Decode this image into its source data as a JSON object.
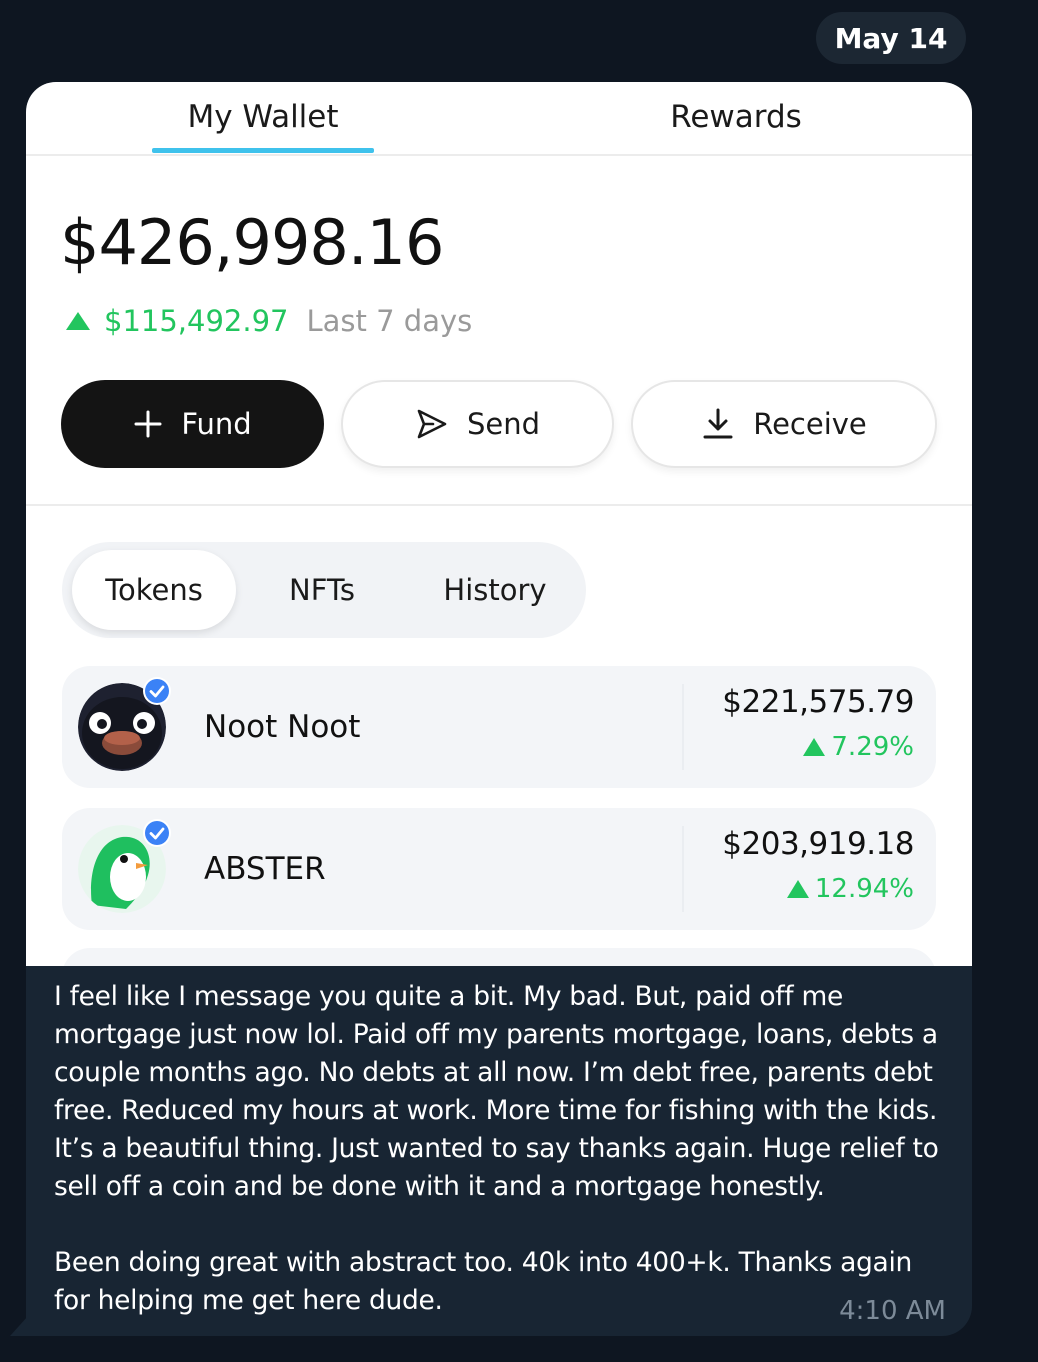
{
  "chat": {
    "date": "May 14",
    "message": "I feel like I message you quite a bit. My bad. But, paid off me mortgage just now lol. Paid off my parents mortgage, loans, debts a couple months ago. No debts at all now. I’m debt free, parents debt free. Reduced my hours at work. More time for fishing with the kids. It’s a beautiful thing. Just wanted to say thanks again. Huge relief to sell off a coin and be done with it and a mortgage honestly.\n\nBeen doing great with abstract too. 40k into 400+k. Thanks again for helping me get here dude.",
    "time": "4:10 AM"
  },
  "wallet": {
    "tabs": [
      "My Wallet",
      "Rewards"
    ],
    "active_tab": "My Wallet",
    "balance": "$426,998.16",
    "change": {
      "value": "$115,492.97",
      "period": "Last 7 days",
      "direction": "up"
    },
    "actions": [
      {
        "label": "Fund",
        "icon": "plus-icon"
      },
      {
        "label": "Send",
        "icon": "send-icon"
      },
      {
        "label": "Receive",
        "icon": "download-icon"
      }
    ],
    "segments": [
      "Tokens",
      "NFTs",
      "History"
    ],
    "active_segment": "Tokens",
    "tokens": [
      {
        "name": "Noot Noot",
        "value": "$221,575.79",
        "change": "7.29%",
        "icon": "penguin-avatar",
        "verified": true
      },
      {
        "name": "ABSTER",
        "value": "$203,919.18",
        "change": "12.94%",
        "icon": "green-penguin-avatar",
        "verified": true
      }
    ]
  },
  "colors": {
    "chat_bg": "#0e1621",
    "bubble_bg": "#182533",
    "accent": "#3fc2ec",
    "positive": "#22c55e",
    "verify_badge": "#3b82f6"
  }
}
